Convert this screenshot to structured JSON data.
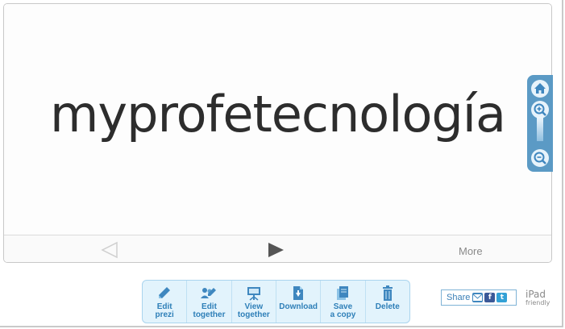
{
  "presentation": {
    "title": "myprofetecnología"
  },
  "nav": {
    "more_label": "More",
    "prev_icon": "triangle-left-outline",
    "play_icon": "triangle-right-solid"
  },
  "zoom_panel": {
    "home_icon": "home-icon",
    "zoom_in_icon": "magnifier-plus-icon",
    "zoom_out_icon": "magnifier-minus-icon"
  },
  "toolbar": {
    "items": [
      {
        "label": "Edit\nprezi",
        "icon": "pencil-icon"
      },
      {
        "label": "Edit\ntogether",
        "icon": "people-pencil-icon"
      },
      {
        "label": "View\ntogether",
        "icon": "projector-icon"
      },
      {
        "label": "Download",
        "icon": "download-icon"
      },
      {
        "label": "Save\na copy",
        "icon": "copy-icon"
      },
      {
        "label": "Delete",
        "icon": "trash-icon"
      }
    ]
  },
  "share": {
    "label": "Share",
    "email_icon": "envelope-icon",
    "facebook_letter": "f",
    "twitter_letter": "t"
  },
  "ipad_badge": {
    "line1": "iPad",
    "line2": "friendly"
  },
  "colors": {
    "accent": "#5b9ac5",
    "toolbar_bg": "#e2f3fc",
    "toolbar_text": "#2e7fb8",
    "title_text": "#2d2d2d"
  }
}
